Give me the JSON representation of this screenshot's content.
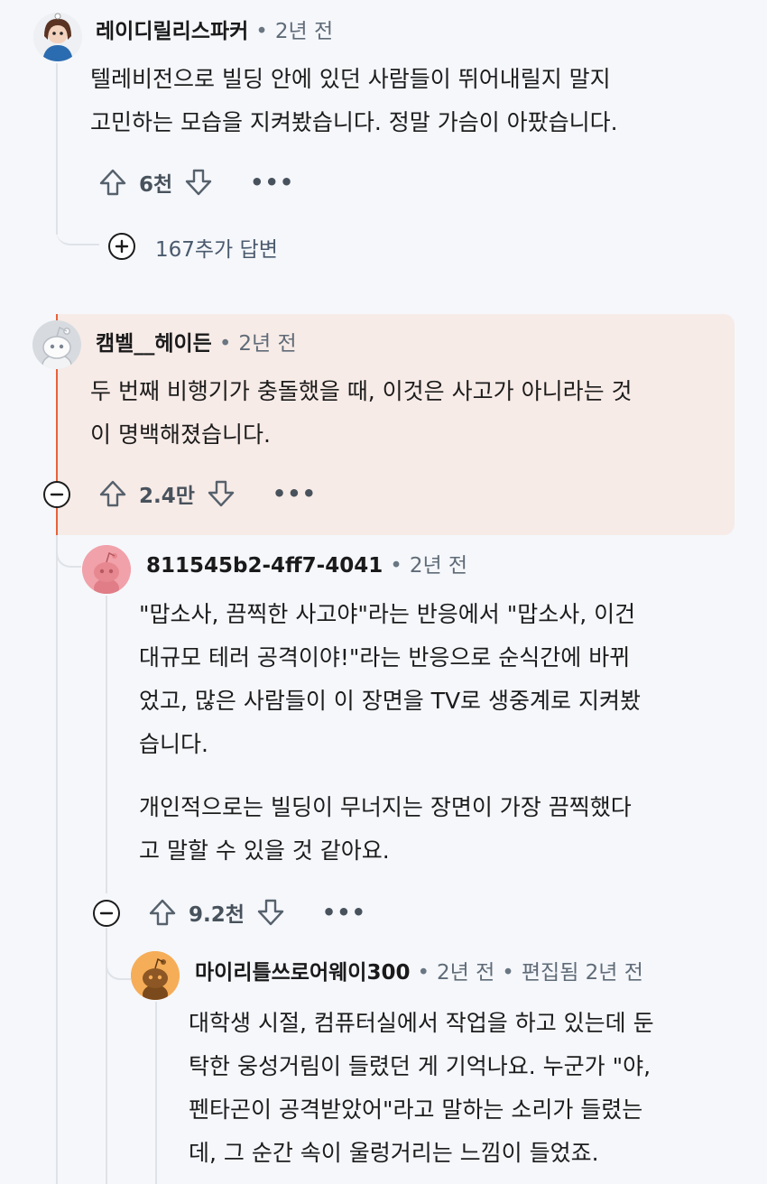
{
  "comments": [
    {
      "username": "레이디릴리스파커",
      "time": "2년 전",
      "lines": [
        "텔레비전으로 빌딩 안에 있던 사람들이 뛰어내릴지 말지",
        "고민하는 모습을 지켜봤습니다. 정말 가슴이 아팠습니다."
      ],
      "score": "6천"
    },
    {
      "username": "캠벨__헤이든",
      "time": "2년 전",
      "lines": [
        "두 번째 비행기가 충돌했을 때, 이것은 사고가 아니라는 것",
        "이 명백해졌습니다."
      ],
      "score": "2.4만"
    },
    {
      "username": "811545b2-4ff7-4041",
      "time": "2년 전",
      "lines": [
        "\"맙소사, 끔찍한 사고야\"라는 반응에서 \"맙소사, 이건",
        "대규모 테러 공격이야!\"라는 반응으로 순식간에 바뀌",
        "었고, 많은 사람들이 이 장면을 TV로 생중계로 지켜봤",
        "습니다."
      ],
      "lines2": [
        "개인적으로는 빌딩이 무너지는 장면이 가장 끔찍했다",
        "고 말할 수 있을 것 같아요."
      ],
      "score": "9.2천"
    },
    {
      "username": "마이리틀쓰로어웨이300",
      "time": "2년 전",
      "edited": "편집됨 2년 전",
      "lines": [
        "대학생 시절, 컴퓨터실에서 작업을 하고 있는데 둔",
        "탁한 웅성거림이 들렸던 게 기억나요. 누군가 \"야,",
        "펜타곤이 공격받았어\"라고 말하는 소리가 들렸는",
        "데, 그 순간 속이 울렁거리는 느낌이 들었죠."
      ]
    }
  ],
  "more_replies": "167추가 답변",
  "dot": "•",
  "more_label": "•••",
  "colors": {
    "accent": "#e8623a",
    "highlight_bg": "#f7ebe7",
    "thread": "#dfe3e8"
  },
  "icons": [
    "upvote-icon",
    "downvote-icon",
    "plus-circle-icon",
    "minus-circle-icon",
    "more-icon",
    "avatar"
  ]
}
